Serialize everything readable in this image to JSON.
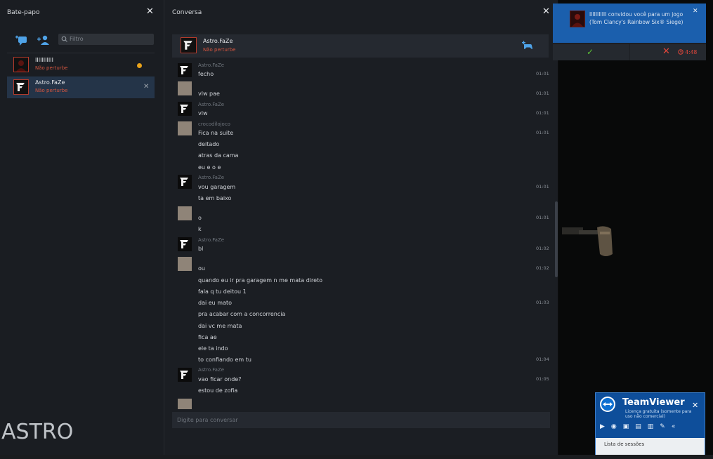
{
  "chat_list": {
    "title": "Bate-papo",
    "filter_placeholder": "Filtro",
    "contacts": [
      {
        "name": "IIIIIIIIIII",
        "status": "Não perturbe"
      },
      {
        "name": "Astro.FaZe",
        "status": "Não perturbe"
      }
    ]
  },
  "conversation": {
    "title": "Conversa",
    "header": {
      "name": "Astro.FaZe",
      "status": "Não perturbe"
    },
    "input_placeholder": "Digite para conversar",
    "messages": [
      {
        "sender": "Astro.FaZe",
        "text": "fecho",
        "time": "01:01"
      },
      {
        "sender": "",
        "text": "vlw pae",
        "time": "01:01"
      },
      {
        "sender": "Astro.FaZe",
        "text": "vlw",
        "time": "01:01"
      },
      {
        "sender": "crocodilojoco",
        "text": "Fica na suite",
        "time": "01:01"
      },
      {
        "sender": "",
        "text": "deitado",
        "time": ""
      },
      {
        "sender": "",
        "text": "atras da cama",
        "time": ""
      },
      {
        "sender": "",
        "text": "eu e o e",
        "time": ""
      },
      {
        "sender": "Astro.FaZe",
        "text": "vou garagem",
        "time": "01:01"
      },
      {
        "sender": "",
        "text": "ta em baixo",
        "time": ""
      },
      {
        "sender": "",
        "text": "o",
        "time": "01:01"
      },
      {
        "sender": "",
        "text": "k",
        "time": ""
      },
      {
        "sender": "Astro.FaZe",
        "text": "bl",
        "time": "01:02"
      },
      {
        "sender": "",
        "text": "ou",
        "time": "01:02"
      },
      {
        "sender": "",
        "text": "quando eu ir pra garagem n me mata direto",
        "time": ""
      },
      {
        "sender": "",
        "text": "fala q tu deitou 1",
        "time": ""
      },
      {
        "sender": "",
        "text": "dai eu mato",
        "time": "01:03"
      },
      {
        "sender": "",
        "text": "pra acabar com a concorrencia",
        "time": ""
      },
      {
        "sender": "",
        "text": "dai vc me mata",
        "time": ""
      },
      {
        "sender": "",
        "text": "fica ae",
        "time": ""
      },
      {
        "sender": "",
        "text": "ele ta indo",
        "time": ""
      },
      {
        "sender": "",
        "text": "to confiando em tu",
        "time": "01:04"
      },
      {
        "sender": "Astro.FaZe",
        "text": "vao ficar onde?",
        "time": "01:05"
      },
      {
        "sender": "",
        "text": "estou de zofia",
        "time": ""
      }
    ]
  },
  "notification": {
    "text": "IIIIIIIIIII convidou você para um jogo (Tom Clancy's Rainbow Six® Siege)",
    "timer": "4:48"
  },
  "teamviewer": {
    "name": "TeamViewer",
    "subtitle": "Licença gratuita (somente para uso não comercial)",
    "sessions_label": "Lista de sessões"
  },
  "overlay_logo": "ASTRO",
  "colors": {
    "accent_blue": "#1b5fad",
    "dnd_red": "#d4553f",
    "selected_row": "#243448"
  },
  "icons": [
    "add-chat-icon",
    "add-friend-icon",
    "search-icon",
    "close-icon",
    "invite-icon",
    "check-icon",
    "clock-icon"
  ]
}
